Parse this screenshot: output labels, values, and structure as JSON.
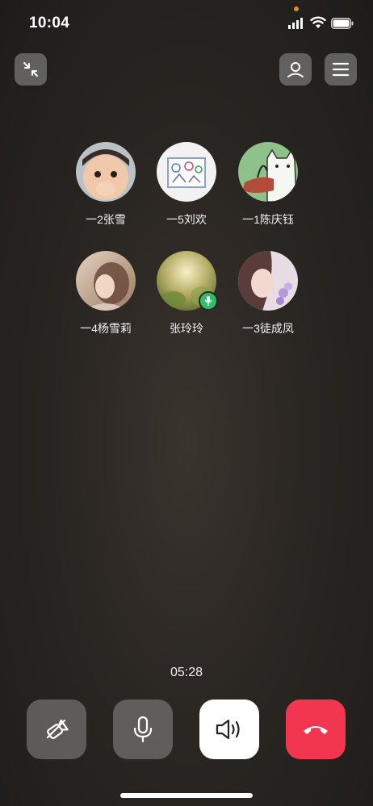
{
  "status_bar": {
    "time": "10:04"
  },
  "call": {
    "timer": "05:28",
    "participants": [
      {
        "name": "一2张雪",
        "avatar": "child-photo-avatar",
        "speaking": false
      },
      {
        "name": "一5刘欢",
        "avatar": "drawing-avatar",
        "speaking": false
      },
      {
        "name": "一1陈庆钰",
        "avatar": "cartoon-cat-avatar",
        "speaking": false
      },
      {
        "name": "一4杨雪莉",
        "avatar": "portrait-avatar",
        "speaking": false
      },
      {
        "name": "张玲玲",
        "avatar": "nature-avatar",
        "speaking": true
      },
      {
        "name": "一3徒成凤",
        "avatar": "girl-flowers-avatar",
        "speaking": false
      }
    ]
  },
  "colors": {
    "hangup": "#f2364f",
    "speaking_badge": "#2fbf6a",
    "control_bg": "#8c8c8c",
    "speaker_bg": "#ffffff"
  },
  "icons": {
    "minimize": "minimize-arrows-icon",
    "contact": "person-icon",
    "menu": "hamburger-menu-icon",
    "camera": "camera-off-icon",
    "mic": "microphone-icon",
    "speaker": "speaker-icon",
    "hangup": "hang-up-icon"
  }
}
